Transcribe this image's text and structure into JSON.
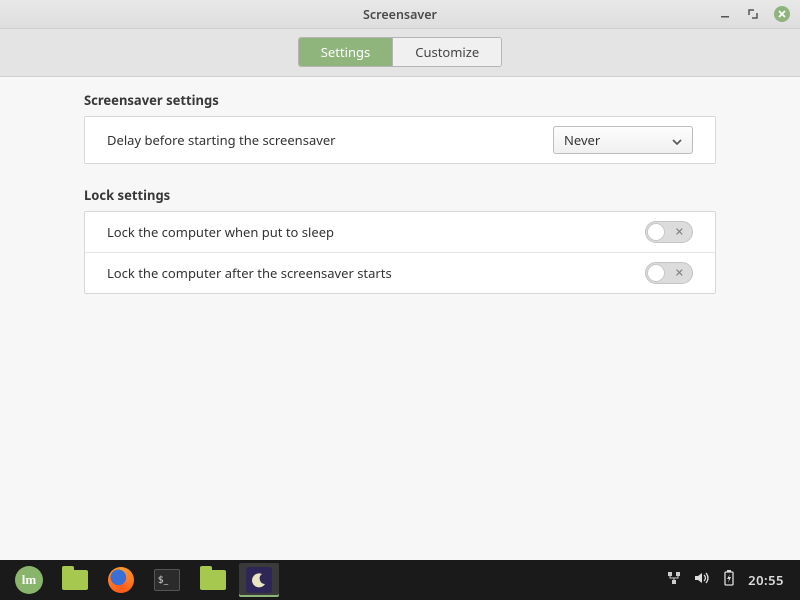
{
  "window": {
    "title": "Screensaver"
  },
  "tabs": {
    "settings": "Settings",
    "customize": "Customize"
  },
  "sections": {
    "screensaver": {
      "title": "Screensaver settings",
      "delay_label": "Delay before starting the screensaver",
      "delay_value": "Never"
    },
    "lock": {
      "title": "Lock settings",
      "sleep_label": "Lock the computer when put to sleep",
      "sleep_on": false,
      "afterss_label": "Lock the computer after the screensaver starts",
      "afterss_on": false
    }
  },
  "taskbar": {
    "mint_logo": "lm",
    "terminal_prompt": "$_",
    "clock": "20:55"
  }
}
